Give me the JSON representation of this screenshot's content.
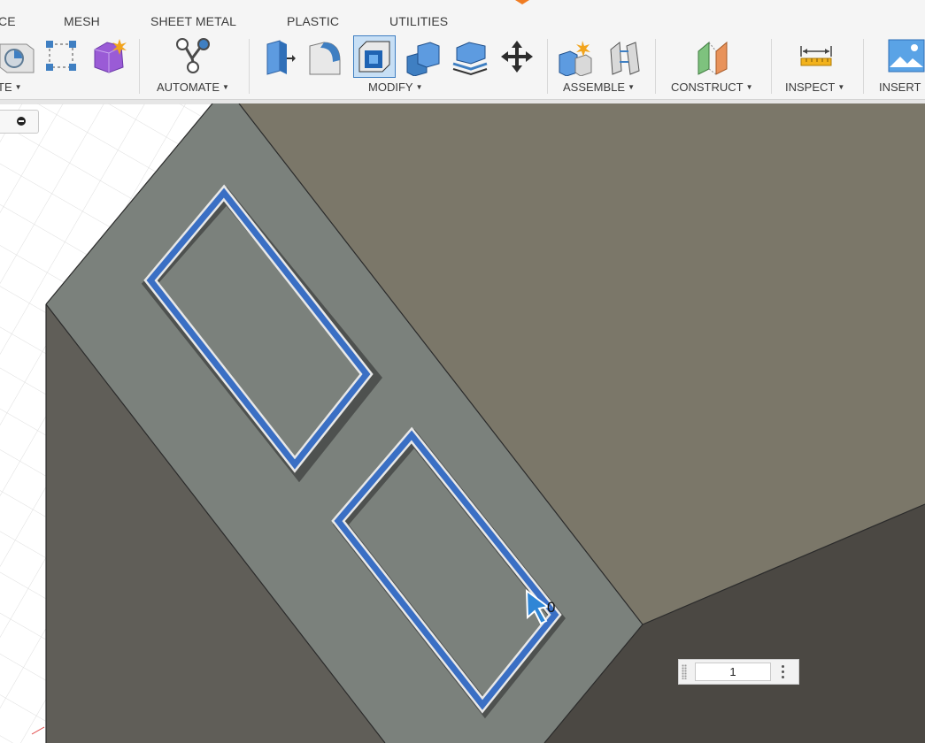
{
  "tabs": [
    "CE",
    "MESH",
    "SHEET METAL",
    "PLASTIC",
    "UTILITIES"
  ],
  "groups": {
    "create": "TE",
    "automate": "AUTOMATE",
    "modify": "MODIFY",
    "assemble": "ASSEMBLE",
    "construct": "CONSTRUCT",
    "inspect": "INSPECT",
    "insert": "INSERT"
  },
  "icons": [
    "revolve-icon",
    "sketch-icon",
    "form-icon",
    "automate-icon",
    "press-pull-icon",
    "fillet-icon",
    "shell-icon",
    "combine-icon",
    "offset-face-icon",
    "move-icon",
    "new-component-icon",
    "joint-icon",
    "construct-plane-icon",
    "measure-icon",
    "insert-image-icon"
  ],
  "colors": {
    "selection_blue": "#3a6fc4",
    "face_gray": "#7b817c",
    "body_dark": "#5f5e58",
    "top_face": "#7b7769",
    "toolbar_bg": "#f5f5f5"
  },
  "count_input": {
    "value": "1"
  },
  "cursor_label": "0"
}
